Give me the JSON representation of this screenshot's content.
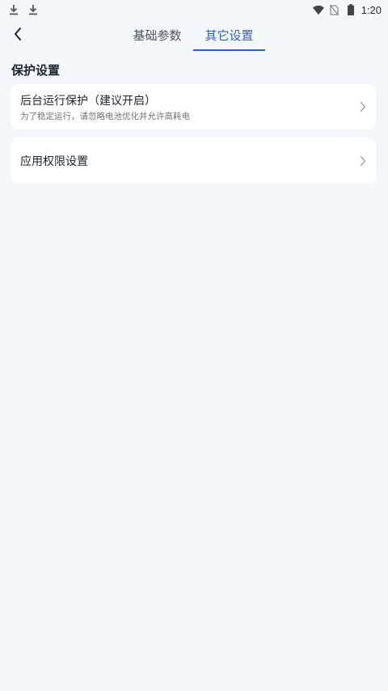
{
  "status_bar": {
    "time": "1:20",
    "left_icons": [
      "download-icon",
      "download-icon"
    ],
    "right_icons": [
      "wifi-icon",
      "no-sim-icon",
      "battery-icon"
    ]
  },
  "header": {
    "back_icon": "chevron-left-icon",
    "tabs": [
      {
        "label": "基础参数",
        "active": false
      },
      {
        "label": "其它设置",
        "active": true
      }
    ]
  },
  "section": {
    "title": "保护设置"
  },
  "items": [
    {
      "title": "后台运行保护（建议开启）",
      "subtitle": "为了稳定运行，请忽略电池优化并允许高耗电",
      "icon": "chevron-right-icon"
    },
    {
      "title": "应用权限设置",
      "icon": "chevron-right-icon"
    }
  ],
  "colors": {
    "accent": "#2f63c8",
    "background": "#f4f7fc",
    "card": "#ffffff"
  }
}
